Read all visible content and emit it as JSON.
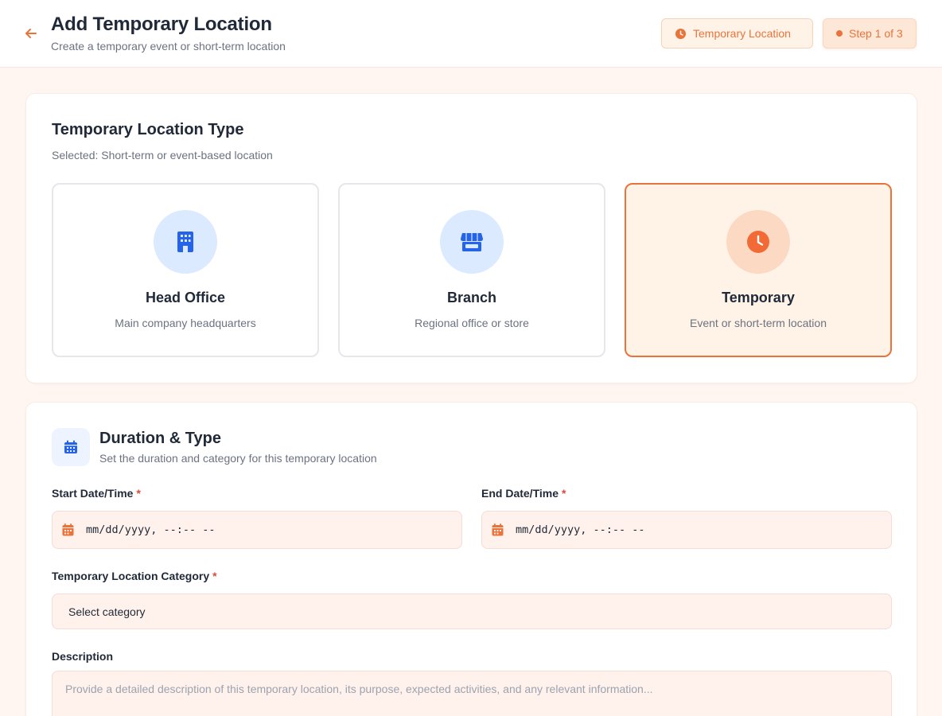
{
  "header": {
    "title": "Add Temporary Location",
    "subtitle": "Create a temporary event or short-term location",
    "badge_location": "Temporary Location",
    "badge_step": "Step 1 of 3",
    "back_icon": "arrow-left-icon",
    "accent_color": "#e8743b"
  },
  "location_type": {
    "title": "Temporary Location Type",
    "subtitle": "Selected: Short-term or event-based location",
    "options": [
      {
        "name": "Head Office",
        "desc": "Main company headquarters",
        "icon": "building-icon",
        "selected": false
      },
      {
        "name": "Branch",
        "desc": "Regional office or store",
        "icon": "store-icon",
        "selected": false
      },
      {
        "name": "Temporary",
        "desc": "Event or short-term location",
        "icon": "clock-icon",
        "selected": true
      }
    ]
  },
  "duration": {
    "title": "Duration & Type",
    "subtitle": "Set the duration and category for this temporary location",
    "icon": "calendar-icon",
    "start_label": "Start Date/Time",
    "end_label": "End Date/Time",
    "required_mark": "*",
    "start_value": "mm/dd/yyyy, --:-- --",
    "end_value": "mm/dd/yyyy, --:-- --",
    "category_label": "Temporary Location Category",
    "category_value": "Select category",
    "description_label": "Description",
    "description_placeholder": "Provide a detailed description of this temporary location, its purpose, expected activities, and any relevant information..."
  }
}
